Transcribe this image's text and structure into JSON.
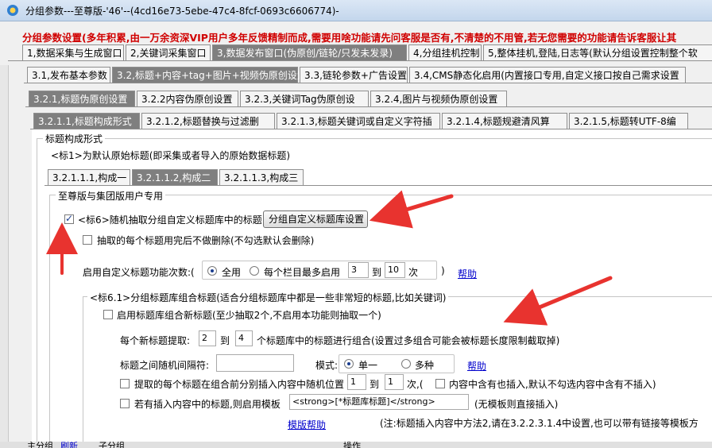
{
  "window": {
    "title": "分组参数---至尊版-'46'--(4cd16e73-5ebe-47c4-8fcf-0693c6606774)-"
  },
  "notice": "分组参数设置(多年积累,由一万余资深VIP用户多年反馈精制而成,需要用啥功能请先问客服是否有,不清楚的不用管,若无您需要的功能请告诉客服让其",
  "tabs_level1": [
    "1,数据采集与生成窗口",
    "2,关键词采集窗口",
    "3,数据发布窗口(伪原创/链轮/只发未发录)",
    "4,分组挂机控制",
    "5,整体挂机,登陆,日志等(默认分组设置控制整个软"
  ],
  "tabs_level2": [
    "3.1,发布基本参数",
    "3.2,标题+内容+tag+图片+视频伪原创设置",
    "3.3,链轮参数+广告设置",
    "3.4,CMS静态化启用(内置接口专用,自定义接口按自己需求设置"
  ],
  "tabs_level3": [
    "3.2.1,标题伪原创设置",
    "3.2.2内容伪原创设置",
    "3.2.3,关键词Tag伪原创设",
    "3.2.4,图片与视频伪原创设置"
  ],
  "tabs_level4": [
    "3.2.1.1,标题构成形式",
    "3.2.1.2,标题替换与过滤删",
    "3.2.1.3,标题关键词或自定义字符插",
    "3.2.1.4,标题规避清风算",
    "3.2.1.5,标题转UTF-8编"
  ],
  "section_title": "标题构成形式",
  "std1_text": "<标1>为默认原始标题(即采集或者导入的原始数据标题)",
  "tabs_level5": [
    "3.2.1.1.1,构成一",
    "3.2.1.1.2,构成二",
    "3.2.1.1.3,构成三"
  ],
  "vip_group_label": "至尊版与集团版用户专用",
  "std6": {
    "checkbox_label": "<标6>随机抽取分组自定义标题库中的标题",
    "checked": true,
    "button": "分组自定义标题库设置",
    "no_delete_label": "抽取的每个标题用完后不做删除(不勾选默认会删除)"
  },
  "usage_count": {
    "label": "启用自定义标题功能次数:(",
    "opt_all": "全用",
    "opt_each": "每个栏目最多启用",
    "min": "3",
    "to": "到",
    "max": "10",
    "unit": "次",
    "close": ")",
    "help": "帮助"
  },
  "std61": {
    "group_label": "<标6.1>分组标题库组合标题(适合分组标题库中都是一些非常短的标题,比如关键词)",
    "enable_label": "启用标题库组合新标题(至少抽取2个,不启用本功能则抽取一个)",
    "extract_label": "每个新标题提取:",
    "extract_min": "2",
    "to": "到",
    "extract_max": "4",
    "extract_suffix": "个标题库中的标题进行组合(设置过多组合可能会被标题长度限制截取掉)",
    "separator_label": "标题之间随机间隔符:",
    "separator_value": "",
    "mode_label": "模式:",
    "mode_single": "单一",
    "mode_multi": "多种",
    "help": "帮助",
    "insert_label": "提取的每个标题在组合前分别插入内容中随机位置",
    "insert_min": "1",
    "insert_max": "1",
    "insert_unit": "次,(",
    "insert_has_label": "内容中含有也插入,默认不勾选内容中含有不插入)",
    "template_label": "若有插入内容中的标题,则启用模板",
    "template_value": "<strong>[*标题库标题]</strong>",
    "template_note": "(无模板则直接插入)",
    "template_help": "模版帮助",
    "note": "(注:标题插入内容中方法2,请在3.2.2.3.1.4中设置,也可以带有链接等模板方"
  },
  "bottom": {
    "left_label": "主分组",
    "refresh": "刷新",
    "sub_label": "子分组",
    "ops": "操作"
  },
  "colors": {
    "notice": "#d00000",
    "active_tab": "#7f7f7f",
    "arrow": "#e8332f",
    "link": "#0000cc"
  }
}
